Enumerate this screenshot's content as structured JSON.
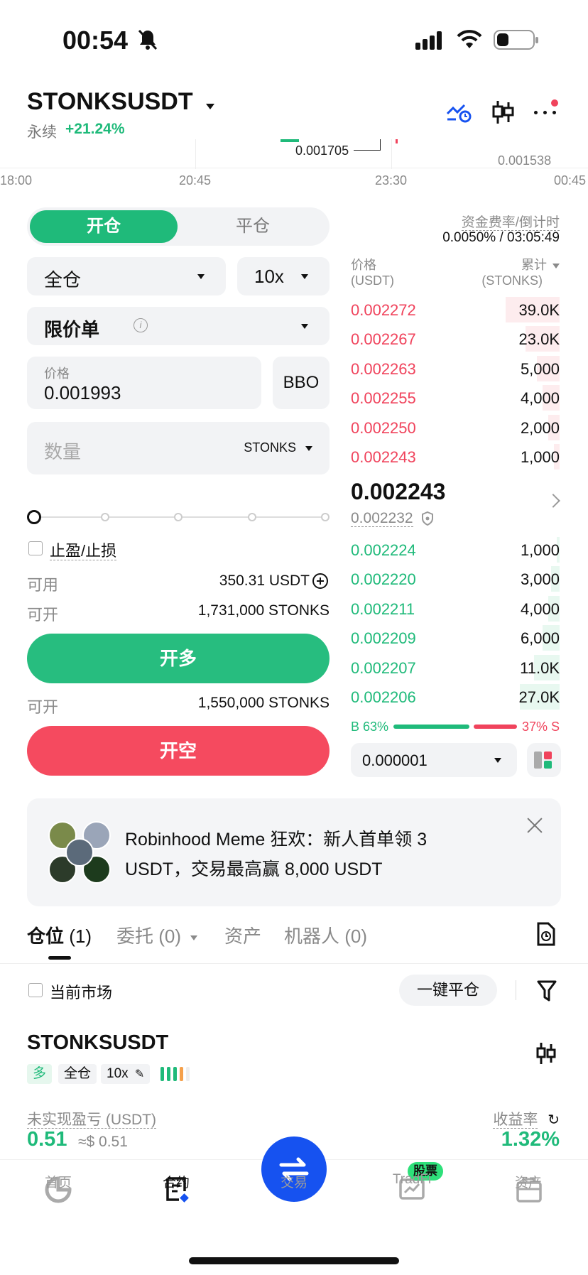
{
  "status_bar": {
    "time": "00:54"
  },
  "header": {
    "symbol": "STONKSUSDT",
    "type": "永续",
    "change": "+21.24%"
  },
  "chart_strip": {
    "price_labels": [
      "0.001705",
      "0.001538"
    ],
    "time_labels": [
      "18:00",
      "20:45",
      "23:30",
      "00:45"
    ]
  },
  "trade_tabs": {
    "open": "开仓",
    "close": "平仓"
  },
  "funding": {
    "label": "资金费率/倒计时",
    "value": "0.0050% / 03:05:49"
  },
  "margin_mode": "全仓",
  "leverage": "10x",
  "order_type": "限价单",
  "price_field": {
    "label": "价格",
    "value": "0.001993",
    "bbo": "BBO"
  },
  "qty_field": {
    "placeholder": "数量",
    "unit": "STONKS"
  },
  "tpsl": "止盈/止损",
  "available": {
    "label": "可用",
    "value": "350.31 USDT"
  },
  "can_open_long": {
    "label": "可开",
    "value": "1,731,000 STONKS"
  },
  "long_button": "开多",
  "can_open_short": {
    "label": "可开",
    "value": "1,550,000 STONKS"
  },
  "short_button": "开空",
  "orderbook": {
    "price_header": "价格",
    "price_unit": "(USDT)",
    "qty_header": "累计",
    "qty_unit": "(STONKS)",
    "asks": [
      {
        "price": "0.002272",
        "qty": "39.0K",
        "depth": 0.95
      },
      {
        "price": "0.002267",
        "qty": "23.0K",
        "depth": 0.6
      },
      {
        "price": "0.002263",
        "qty": "5,000",
        "depth": 0.4
      },
      {
        "price": "0.002255",
        "qty": "4,000",
        "depth": 0.3
      },
      {
        "price": "0.002250",
        "qty": "2,000",
        "depth": 0.2
      },
      {
        "price": "0.002243",
        "qty": "1,000",
        "depth": 0.1
      }
    ],
    "last_price": "0.002243",
    "mark_price": "0.002232",
    "bids": [
      {
        "price": "0.002224",
        "qty": "1,000",
        "depth": 0.05
      },
      {
        "price": "0.002220",
        "qty": "3,000",
        "depth": 0.15
      },
      {
        "price": "0.002211",
        "qty": "4,000",
        "depth": 0.2
      },
      {
        "price": "0.002209",
        "qty": "6,000",
        "depth": 0.3
      },
      {
        "price": "0.002207",
        "qty": "11.0K",
        "depth": 0.45
      },
      {
        "price": "0.002206",
        "qty": "27.0K",
        "depth": 0.7
      }
    ],
    "buy_ratio": "B 63%",
    "sell_ratio": "37% S",
    "buy_ratio_value": 0.63,
    "tick_size": "0.000001"
  },
  "banner": {
    "line1": "Robinhood Meme 狂欢：新人首单领 3",
    "line2": "USDT，交易最高赢 8,000 USDT"
  },
  "bottom_tabs": {
    "positions": "仓位",
    "positions_count": "(1)",
    "orders": "委托 (0)",
    "assets": "资产",
    "bots": "机器人 (0)"
  },
  "filter": {
    "current_market": "当前市场",
    "close_all": "一键平仓"
  },
  "position": {
    "symbol": "STONKSUSDT",
    "side": "多",
    "mode": "全仓",
    "leverage": "10x",
    "pnl_label": "未实现盈亏 (USDT)",
    "pnl_value": "0.51",
    "pnl_usd": "≈$ 0.51",
    "roe_label": "收益率",
    "roe_value": "1.32%"
  },
  "nav": {
    "home": "首页",
    "contracts": "合约",
    "trade": "交易",
    "tradfi": "TradFi",
    "stocks_badge": "股票",
    "assets": "资产"
  },
  "colors": {
    "green": "#1fba7a",
    "red": "#f0435c",
    "blue": "#1652f0"
  }
}
